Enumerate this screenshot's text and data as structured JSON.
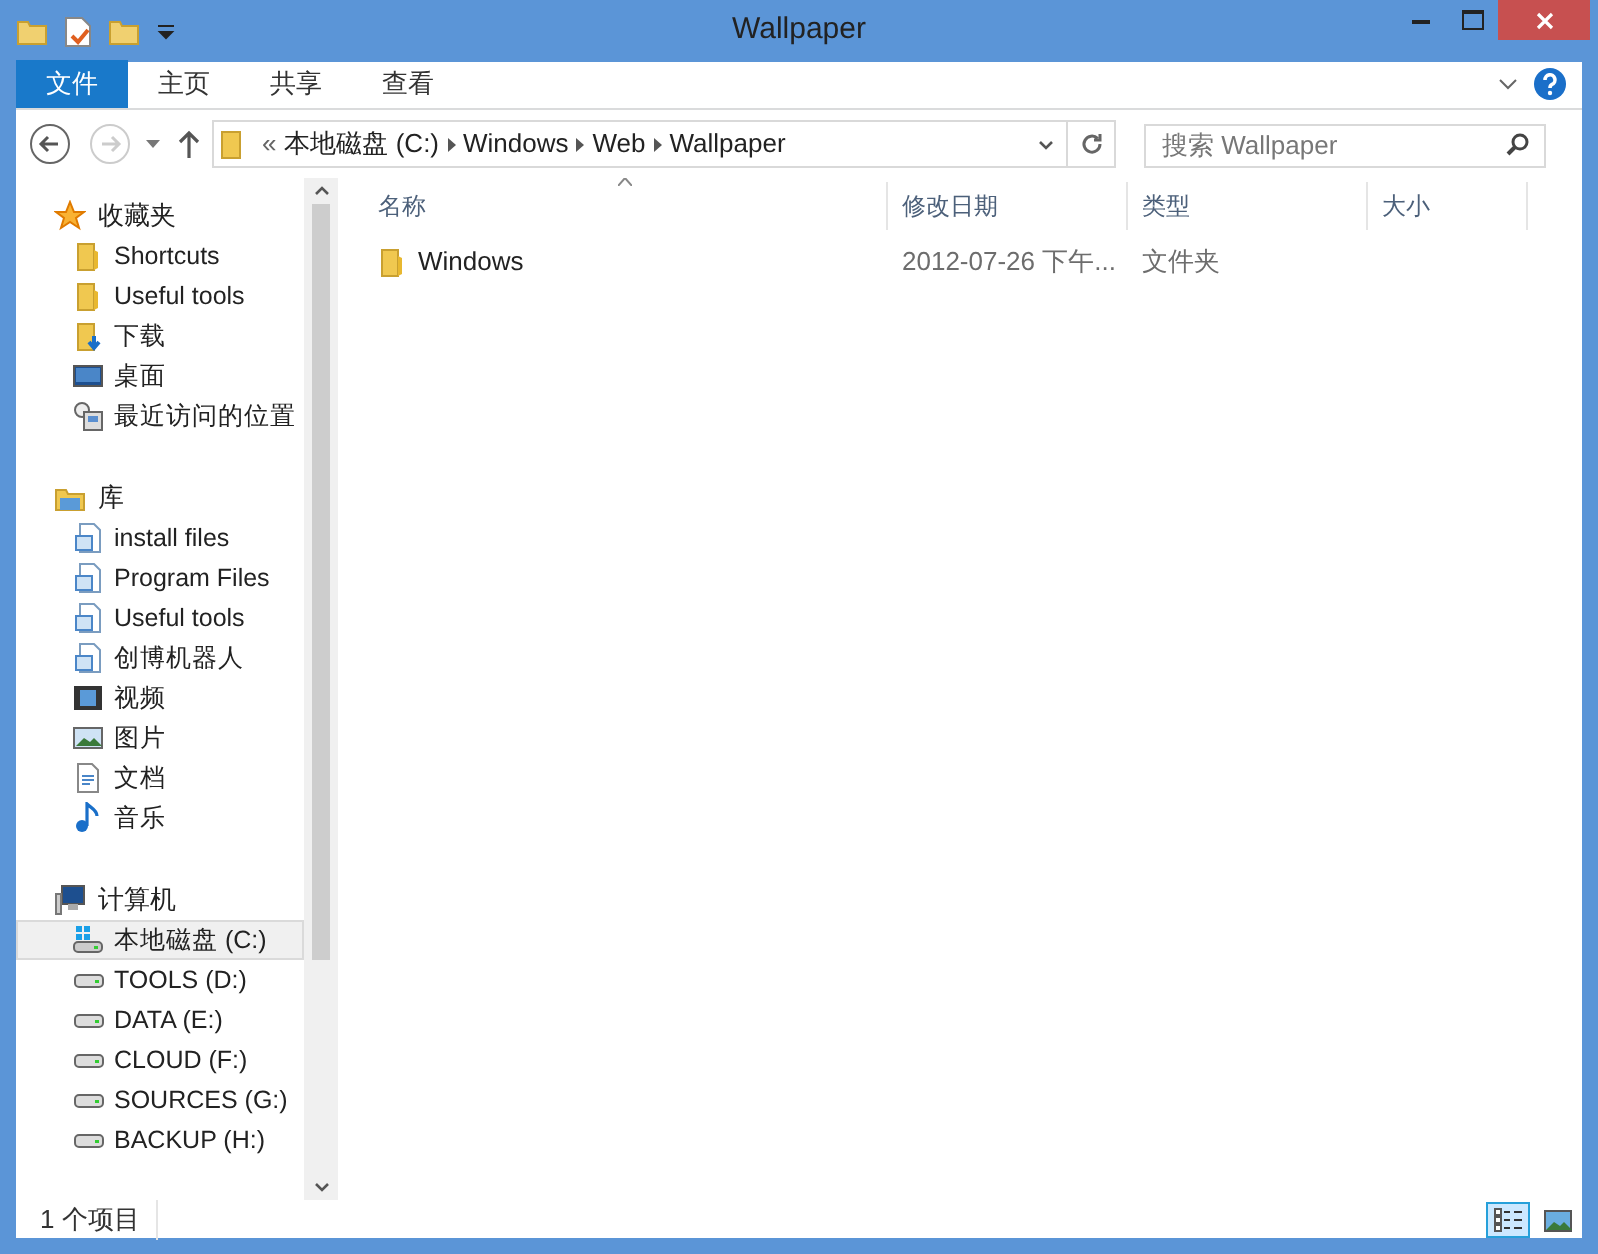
{
  "window": {
    "title": "Wallpaper"
  },
  "ribbon_tabs": [
    {
      "label": "文件",
      "selected": true
    },
    {
      "label": "主页",
      "selected": false
    },
    {
      "label": "共享",
      "selected": false
    },
    {
      "label": "查看",
      "selected": false
    }
  ],
  "address": {
    "overflow": "«",
    "crumbs": [
      "本地磁盘 (C:)",
      "Windows",
      "Web",
      "Wallpaper"
    ]
  },
  "search": {
    "placeholder": "搜索 Wallpaper"
  },
  "sidebar": {
    "groups": [
      {
        "label": "收藏夹",
        "kind": "star",
        "items": [
          {
            "label": "Shortcuts",
            "kind": "folder",
            "selected": false
          },
          {
            "label": "Useful tools",
            "kind": "folder",
            "selected": false
          },
          {
            "label": "下载",
            "kind": "download",
            "selected": false
          },
          {
            "label": "桌面",
            "kind": "desktop",
            "selected": false
          },
          {
            "label": "最近访问的位置",
            "kind": "recent",
            "selected": false
          }
        ]
      },
      {
        "label": "库",
        "kind": "library",
        "items": [
          {
            "label": "install files",
            "kind": "doc",
            "selected": false
          },
          {
            "label": "Program Files",
            "kind": "doc",
            "selected": false
          },
          {
            "label": "Useful tools",
            "kind": "doc",
            "selected": false
          },
          {
            "label": "创博机器人",
            "kind": "doc",
            "selected": false
          },
          {
            "label": "视频",
            "kind": "video",
            "selected": false
          },
          {
            "label": "图片",
            "kind": "image",
            "selected": false
          },
          {
            "label": "文档",
            "kind": "text",
            "selected": false
          },
          {
            "label": "音乐",
            "kind": "music",
            "selected": false
          }
        ]
      },
      {
        "label": "计算机",
        "kind": "computer",
        "items": [
          {
            "label": "本地磁盘 (C:)",
            "kind": "sysdrive",
            "selected": true
          },
          {
            "label": "TOOLS (D:)",
            "kind": "drive",
            "selected": false
          },
          {
            "label": "DATA (E:)",
            "kind": "drive",
            "selected": false
          },
          {
            "label": "CLOUD (F:)",
            "kind": "drive",
            "selected": false
          },
          {
            "label": "SOURCES (G:)",
            "kind": "drive",
            "selected": false
          },
          {
            "label": "BACKUP (H:)",
            "kind": "drive",
            "selected": false
          }
        ]
      }
    ]
  },
  "table": {
    "columns": [
      "名称",
      "修改日期",
      "类型",
      "大小"
    ],
    "rows": [
      {
        "name": "Windows",
        "modified": "2012-07-26 下午...",
        "type": "文件夹"
      }
    ]
  },
  "status_bar": {
    "count": "1 个项目"
  }
}
